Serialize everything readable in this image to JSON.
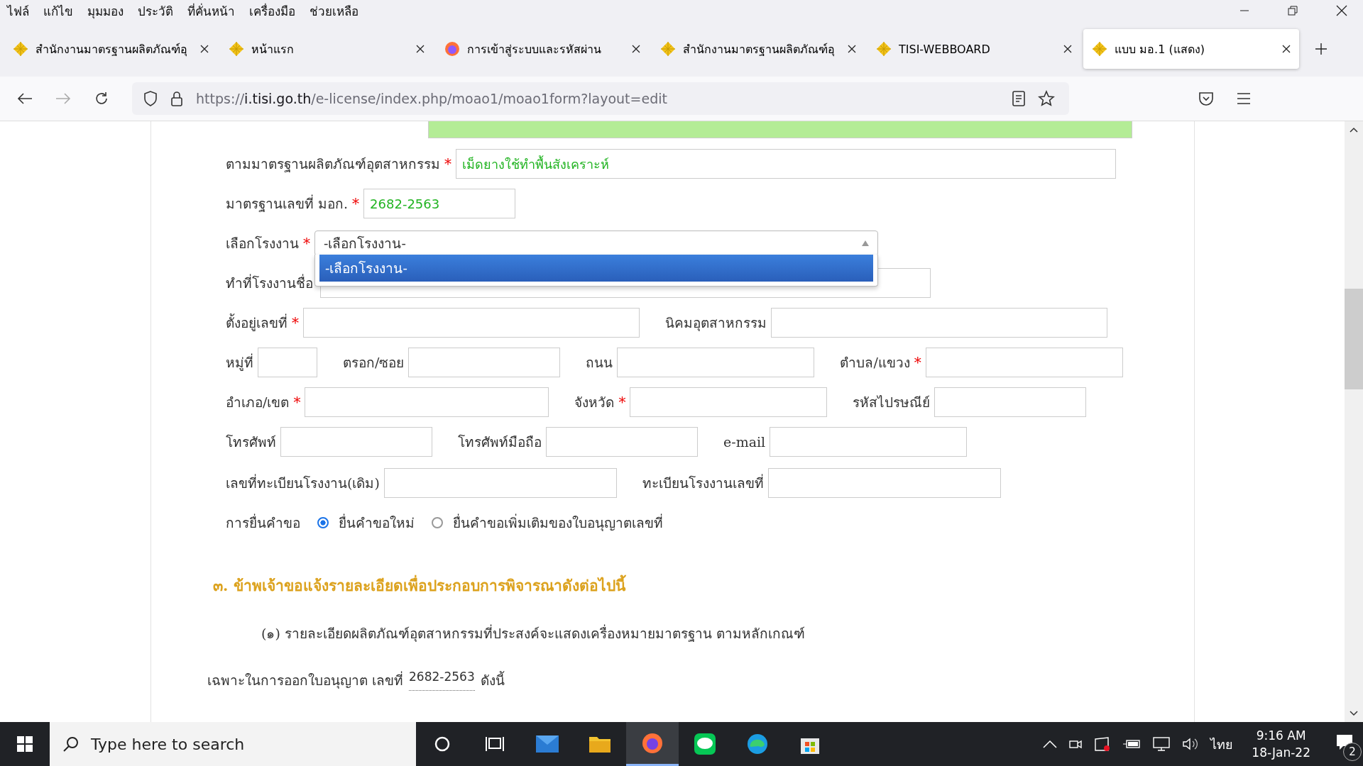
{
  "menu": [
    "ไฟล์",
    "แก้ไข",
    "มุมมอง",
    "ประวัติ",
    "ที่คั่นหน้า",
    "เครื่องมือ",
    "ช่วยเหลือ"
  ],
  "tabs": [
    {
      "title": "สำนักงานมาตรฐานผลิตภัณฑ์อุ",
      "kind": "tisi",
      "selected": false
    },
    {
      "title": "หน้าแรก",
      "kind": "tisi",
      "selected": false
    },
    {
      "title": "การเข้าสู่ระบบและรหัสผ่าน",
      "kind": "firefox",
      "selected": false
    },
    {
      "title": "สำนักงานมาตรฐานผลิตภัณฑ์อุ",
      "kind": "tisi",
      "selected": false
    },
    {
      "title": "TISI-WEBBOARD",
      "kind": "tisi",
      "selected": false
    },
    {
      "title": "แบบ มอ.1 (แสดง)",
      "kind": "tisi",
      "selected": true
    }
  ],
  "address": {
    "scheme": "https://",
    "host": "i.tisi.go.th",
    "path": "/e-license/index.php/moao1/moao1form?layout=edit"
  },
  "form": {
    "standard": {
      "label": "ตามมาตรฐานผลิตภัณฑ์อุตสาหกรรม",
      "mark": "*",
      "value": "เม็ดยางใช้ทำพื้นสังเคราะห์"
    },
    "standard_no": {
      "label": "มาตรฐานเลขที่ มอก.",
      "mark": "*",
      "value": "2682-2563"
    },
    "factory_select": {
      "label": "เลือกโรงงาน",
      "mark": "*",
      "value": "-เลือกโรงงาน-",
      "options": [
        {
          "label": "-เลือกโรงงาน-",
          "selected": true
        }
      ]
    },
    "factory_name": {
      "label": "ทำที่โรงงานชื่อ"
    },
    "lines": [
      {
        "fields": [
          {
            "label": "ตั้งอยู่เลขที่",
            "mark": "*"
          },
          {
            "label": "นิคมอุตสาหกรรม"
          }
        ]
      },
      {
        "fields": [
          {
            "label": "หมู่ที่"
          },
          {
            "label": "ตรอก/ซอย"
          },
          {
            "label": "ถนน"
          },
          {
            "label": "ตำบล/แขวง",
            "mark": "*"
          }
        ]
      },
      {
        "fields": [
          {
            "label": "อำเภอ/เขต",
            "mark": "*"
          },
          {
            "label": "จังหวัด",
            "mark": "*"
          },
          {
            "label": "รหัสไปรษณีย์"
          }
        ]
      },
      {
        "fields": [
          {
            "label": "โทรศัพท์"
          },
          {
            "label": "โทรศัพท์มือถือ"
          },
          {
            "label": "e-mail"
          }
        ]
      },
      {
        "fields": [
          {
            "label": "เลขที่ทะเบียนโรงงาน(เดิม)"
          },
          {
            "label": "ทะเบียนโรงงานเลขที่"
          }
        ]
      }
    ],
    "request": {
      "label": "การยื่นคำขอ",
      "options": [
        {
          "label": "ยื่นคำขอใหม่",
          "selected": true
        },
        {
          "label": "ยื่นคำขอเพิ่มเติมของใบอนุญาตเลขที่",
          "selected": false
        }
      ]
    }
  },
  "section": {
    "heading": "๓. ข้าพเจ้าขอแจ้งรายละเอียดเพื่อประกอบการพิจารณาดังต่อไปนี้",
    "paragraph": "(๑) รายละเอียดผลิตภัณฑ์อุตสาหกรรมที่ประสงค์จะแสดงเครื่องหมายมาตรฐาน ตามหลักเกณฑ์",
    "license_prefix": "เฉพาะในการออกใบอนุญาต เลขที่",
    "license_no": "2682-2563",
    "license_suffix": "ดังนี้"
  },
  "taskbar": {
    "search_placeholder": "Type here to search",
    "apps": [
      {
        "kind": "cortana",
        "selected": false
      },
      {
        "kind": "taskview",
        "selected": false
      },
      {
        "kind": "mail",
        "selected": false
      },
      {
        "kind": "explorer",
        "selected": false
      },
      {
        "kind": "firefox",
        "selected": true
      },
      {
        "kind": "line",
        "selected": false
      },
      {
        "kind": "edge",
        "selected": false
      },
      {
        "kind": "store",
        "selected": false
      }
    ],
    "language": "ไทย",
    "time": "9:16 AM",
    "date": "18-Jan-22",
    "notifications": "2"
  }
}
